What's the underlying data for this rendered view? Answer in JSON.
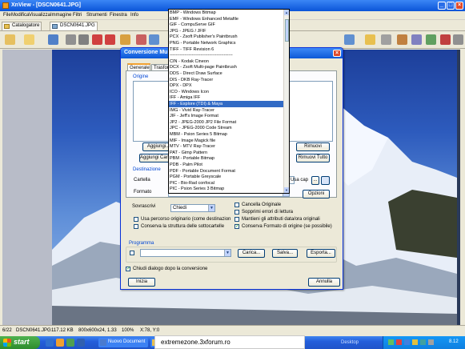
{
  "window": {
    "title": "XnView - [DSCN0641.JPG]"
  },
  "menubar": {
    "items": [
      "File",
      "Modifica",
      "Visualizza",
      "Immagine",
      "Filtri",
      "Strumenti",
      "Finestra",
      "Info"
    ]
  },
  "tabs": [
    {
      "label": "Catalogatore"
    },
    {
      "label": "DSCN0641.JPG"
    }
  ],
  "status": {
    "index": "6/22",
    "filename": "DSCN0641.JPG",
    "filesize": "117.12 KB",
    "dimensions": "800x600x24, 1.33",
    "zoom": "100%",
    "coords": "X:78, Y:0"
  },
  "taskbar": {
    "start_label": "start",
    "tasks": [
      "Nuovo Document",
      "",
      "",
      ""
    ],
    "desktop_label": "Desktop",
    "clock": "8.12"
  },
  "watermark": "extremezone.3xforum.ro",
  "dialog": {
    "title": "Conversione Multipla",
    "tabs": [
      "Generale",
      "Trasformazioni"
    ],
    "origine_label": "Origine",
    "buttons": {
      "aggiungi": "Aggiungi...",
      "aggiungi_cartella": "Aggiungi Cartella...",
      "rimuovi": "Rimuovi",
      "rimuovi_tutto": "Rimuovi Tutto",
      "browse": "...",
      "opzioni": "Opzioni",
      "carica": "Carica...",
      "salva": "Salva...",
      "esporta": "Esporta...",
      "inizia": "Inizia",
      "annulla": "Annulla"
    },
    "destinazione": {
      "label": "Destinazione",
      "cartella_label": "Cartella",
      "cartella_value": "",
      "usa_cap": "Usa cap",
      "formato_label": "Formato",
      "formato_value": "JPG - JPEG / JFIF"
    },
    "sovrascrivi": {
      "label": "Sovrascrivi",
      "value": "Chiedi"
    },
    "checks": [
      {
        "label": "Cancella Originale",
        "checked": false
      },
      {
        "label": "Sopprimi errori di lettura",
        "checked": false
      },
      {
        "label": "Mantieni gli attributi data/ora originali",
        "checked": false
      },
      {
        "label": "Conserva Formato di origine (se possibile)",
        "checked": true
      }
    ],
    "left_checks": [
      {
        "label": "Usa percorso originario (come destinazion",
        "checked": false
      },
      {
        "label": "Conserva la struttura delle sottocartelle",
        "checked": false
      }
    ],
    "programma_label": "Programma",
    "chiudi_label": "Chiudi dialogo dopo la conversione",
    "chiudi_checked": true
  },
  "format_list": {
    "items": [
      "BMP - Windows Bitmap",
      "EMF - Windows Enhanced Metafile",
      "GIF - CompuServe GIF",
      "JPG - JPEG / JFIF",
      "PCX - Zsoft Publisher's Paintbrush",
      "PNG - Portable Network Graphics",
      "TIFF - TIFF Revision 6",
      "-------------------------------------------",
      "CIN - Kodak Cineon",
      "DCX - Zsoft Multi-page Paintbrush",
      "DDS - Direct Draw Surface",
      "DIS - DKB Ray-Tracer",
      "DPX - DPX",
      "ICO - Windows Icon",
      "IFF - Amiga IFF",
      "IFF - Explore (TDI) & Maya",
      "IMG - Vivid Ray-Tracer",
      "JIF - Jeff's Image Format",
      "JP2 - JPEG-2000 JP2 File Format",
      "JPC - JPEG-2000 Code Stream",
      "MBM - Psion Series 5 Bitmap",
      "MIF - Image Magick file",
      "MTV - MTV Ray-Tracer",
      "PAT - Gimp Pattern",
      "PBM - Portable Bitmap",
      "PDB - Palm Pilot",
      "PDF - Portable Document Format",
      "PGM - Portable Greyscale",
      "PIC - Bio-Rad confocal",
      "PIC - Psion Series 3 Bitmap"
    ],
    "selected_index": 15
  }
}
